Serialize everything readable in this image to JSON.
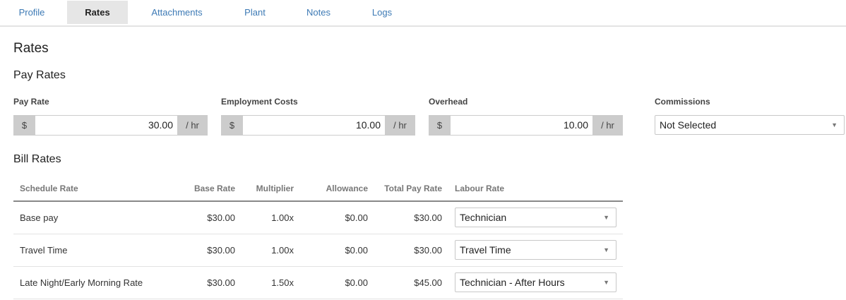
{
  "tabs": [
    {
      "label": "Profile",
      "active": false
    },
    {
      "label": "Rates",
      "active": true
    },
    {
      "label": "Attachments",
      "active": false
    },
    {
      "label": "Plant",
      "active": false
    },
    {
      "label": "Notes",
      "active": false
    },
    {
      "label": "Logs",
      "active": false
    }
  ],
  "page_title": "Rates",
  "pay_rates": {
    "heading": "Pay Rates",
    "currency_symbol": "$",
    "unit": "/ hr",
    "pay_rate": {
      "label": "Pay Rate",
      "value": "30.00"
    },
    "employment_costs": {
      "label": "Employment Costs",
      "value": "10.00"
    },
    "overhead": {
      "label": "Overhead",
      "value": "10.00"
    },
    "commissions": {
      "label": "Commissions",
      "value": "Not Selected"
    }
  },
  "bill_rates": {
    "heading": "Bill Rates",
    "columns": [
      "Schedule Rate",
      "Base Rate",
      "Multiplier",
      "Allowance",
      "Total Pay Rate",
      "Labour Rate"
    ],
    "rows": [
      {
        "schedule_rate": "Base pay",
        "base_rate": "$30.00",
        "multiplier": "1.00x",
        "allowance": "$0.00",
        "total_pay_rate": "$30.00",
        "labour_rate": "Technician"
      },
      {
        "schedule_rate": "Travel Time",
        "base_rate": "$30.00",
        "multiplier": "1.00x",
        "allowance": "$0.00",
        "total_pay_rate": "$30.00",
        "labour_rate": "Travel Time"
      },
      {
        "schedule_rate": "Late Night/Early Morning Rate",
        "base_rate": "$30.00",
        "multiplier": "1.50x",
        "allowance": "$0.00",
        "total_pay_rate": "$45.00",
        "labour_rate": "Technician - After Hours"
      }
    ]
  },
  "icons": {
    "dropdown": "caret-down-icon"
  },
  "colors": {
    "tab_link": "#3d7ab5",
    "addon_bg": "#cccccc",
    "active_tab_bg": "#e6e6e6"
  }
}
